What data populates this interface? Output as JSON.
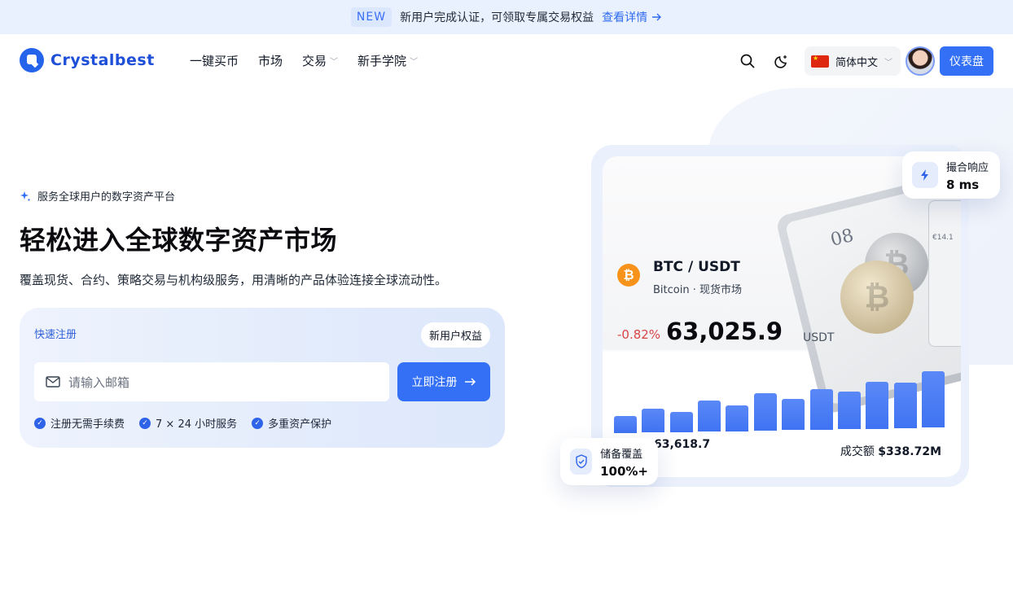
{
  "banner": {
    "badge": "NEW",
    "message": "新用户完成认证，可领取专属交易权益",
    "link_label": "查看详情"
  },
  "header": {
    "brand": "Crystalbest",
    "nav": [
      {
        "label": "一键买币"
      },
      {
        "label": "市场"
      },
      {
        "label": "交易",
        "has_dropdown": true
      },
      {
        "label": "新手学院",
        "has_dropdown": true
      }
    ],
    "language": "简体中文",
    "dashboard_label": "仪表盘"
  },
  "hero": {
    "tagline": "服务全球用户的数字资产平台",
    "title": "轻松进入全球数字资产市场",
    "subtitle": "覆盖现货、合约、策略交易与机构级服务，用清晰的产品体验连接全球流动性。"
  },
  "register": {
    "title": "快速注册",
    "badge": "新用户权益",
    "email_placeholder": "请输入邮箱",
    "submit_label": "立即注册",
    "perks": [
      "注册无需手续费",
      "7 × 24 小时服务",
      "多重资产保护"
    ]
  },
  "market_card": {
    "pair": "BTC / USDT",
    "sub": "Bitcoin · 现货市场",
    "change": "-0.82%",
    "price": "63,025.9",
    "unit": "USDT",
    "low_value": "63,618.7",
    "volume_label": "成交额",
    "volume_value": "$338.72M",
    "bar_levels": [
      0.26,
      0.36,
      0.31,
      0.47,
      0.4,
      0.57,
      0.48,
      0.63,
      0.57,
      0.73,
      0.7,
      0.86
    ],
    "tablet_number": "08",
    "phone_text": "€14.1"
  },
  "floats": {
    "latency_label": "撮合响应",
    "latency_value": "8 ms",
    "reserve_label": "储备覆盖",
    "reserve_value": "100%+"
  },
  "colors": {
    "primary": "#3370f5",
    "brand": "#1d4fd8",
    "negative": "#d64545",
    "bitcoin": "#f7931a"
  },
  "icons": {
    "search": "search-icon",
    "theme": "moon-sparkle-icon",
    "mail": "mail-icon",
    "arrow": "arrow-right-icon",
    "check": "check-circle-icon",
    "bolt": "bolt-icon",
    "shield": "shield-check-icon",
    "sparkle": "sparkle-icon"
  }
}
